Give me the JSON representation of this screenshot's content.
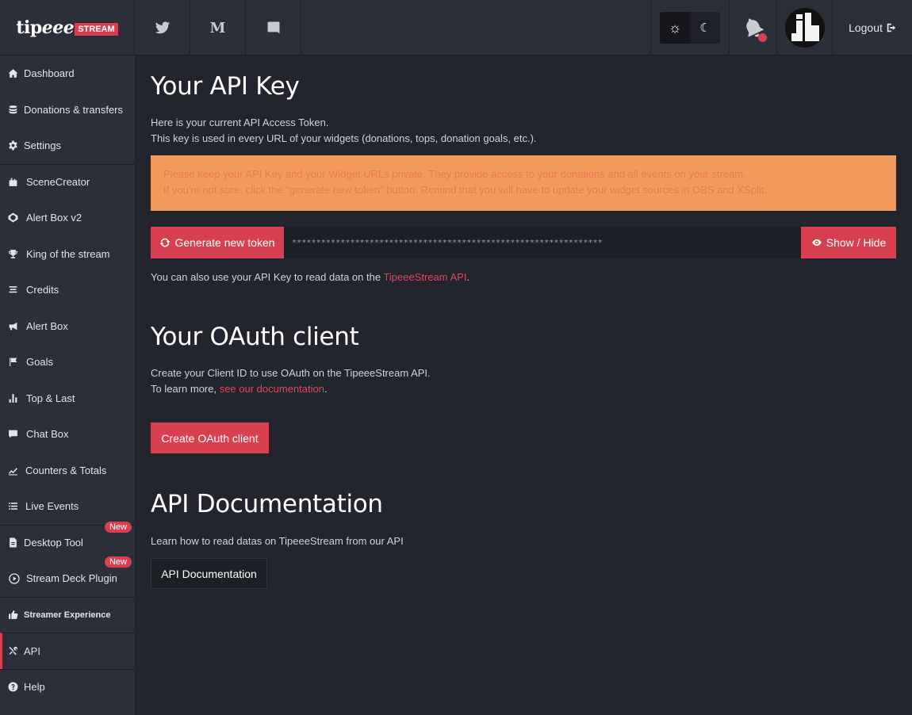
{
  "brand": {
    "name_part1": "tip",
    "name_part2": "eee",
    "badge": "STREAM",
    "accent": "#d9404f"
  },
  "topbar": {
    "social": [
      "twitter-icon",
      "medium-icon",
      "discord-icon"
    ],
    "medium_letter": "M",
    "theme": {
      "light_icon": "☼",
      "dark_icon": "☾",
      "active": "light"
    },
    "logout_label": "Logout"
  },
  "sidebar": {
    "items": [
      {
        "label": "Dashboard",
        "icon": "home-icon"
      },
      {
        "label": "Donations & transfers",
        "icon": "database-icon"
      },
      {
        "label": "Settings",
        "icon": "gear-icon"
      },
      {
        "label": "SceneCreator",
        "icon": "scene-icon"
      },
      {
        "label": "Alert Box v2",
        "icon": "alert-v2-icon"
      },
      {
        "label": "King of the stream",
        "icon": "trophy-icon"
      },
      {
        "label": "Credits",
        "icon": "credits-icon"
      },
      {
        "label": "Alert Box",
        "icon": "megaphone-icon"
      },
      {
        "label": "Goals",
        "icon": "flag-icon"
      },
      {
        "label": "Top & Last",
        "icon": "bar-chart-icon"
      },
      {
        "label": "Chat Box",
        "icon": "chat-icon"
      },
      {
        "label": "Counters & Totals",
        "icon": "line-chart-icon"
      },
      {
        "label": "Live Events",
        "icon": "list-icon"
      },
      {
        "label": "Desktop Tool",
        "icon": "file-icon",
        "badge": "New"
      },
      {
        "label": "Stream Deck Plugin",
        "icon": "play-circle-icon",
        "badge": "New"
      },
      {
        "label": "Streamer Experience",
        "icon": "thumbs-up-icon"
      },
      {
        "label": "API",
        "icon": "tools-icon",
        "active": true
      },
      {
        "label": "Help",
        "icon": "question-icon"
      }
    ]
  },
  "api_key": {
    "title": "Your API Key",
    "intro_line1": "Here is your current API Access Token.",
    "intro_line2": "This key is used in every URL of your widgets (donations, tops, donation goals, etc.).",
    "warning_line1": "Please keep your API Key and your Widget URLs private. They provide access to your donations and all events on your stream.",
    "warning_line2": "If you're not sure, click the \"generate new token\" button. Remind that you will have to update your widget sources in OBS and XSplit.",
    "generate_label": "Generate new token",
    "token_masked": "****************************************************************",
    "show_hide_label": "Show / Hide",
    "read_prefix": "You can also use your API Key to read data on the ",
    "read_link": "TipeeeStream API",
    "read_suffix": "."
  },
  "oauth": {
    "title": "Your OAuth client",
    "line1": "Create your Client ID to use OAuth on the TipeeeStream API.",
    "line2_prefix": "To learn more, ",
    "line2_link": "see our documentation",
    "line2_suffix": ".",
    "button_label": "Create OAuth client"
  },
  "docs": {
    "title": "API Documentation",
    "line": "Learn how to read datas on TipeeeStream from our API",
    "button_label": "API Documentation"
  }
}
